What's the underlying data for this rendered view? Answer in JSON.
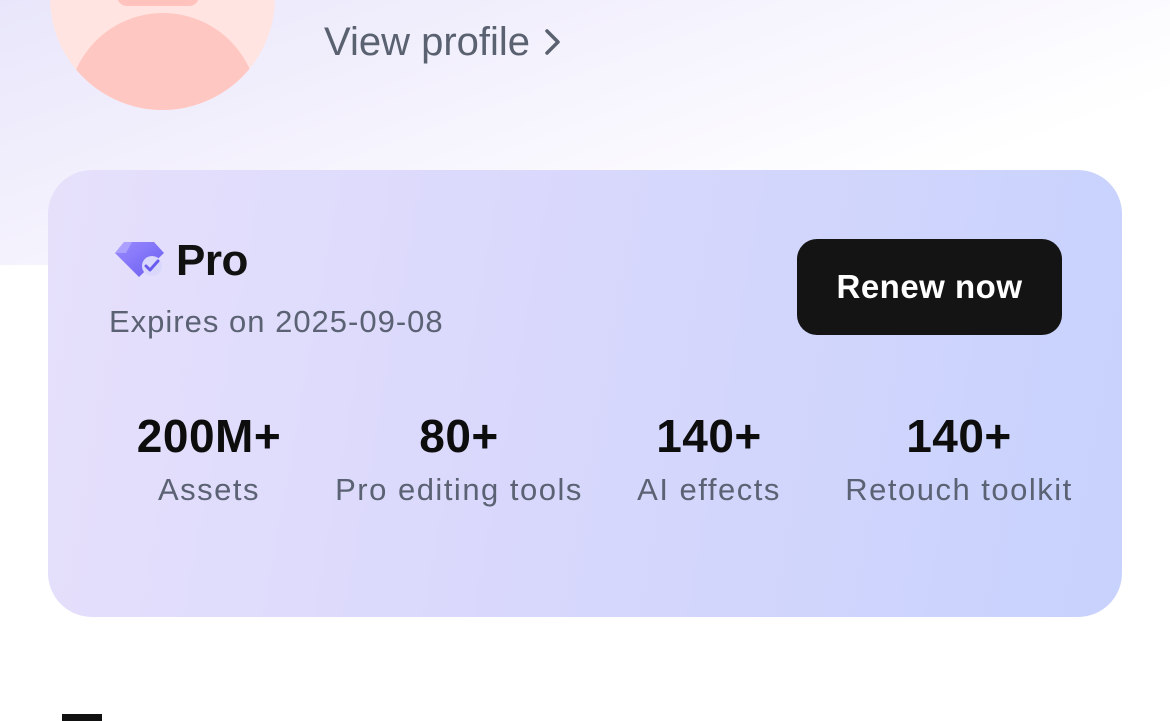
{
  "header": {
    "view_profile_label": "View profile"
  },
  "pro_card": {
    "plan_name": "Pro",
    "expires_text": "Expires on 2025-09-08",
    "renew_label": "Renew now",
    "stats": [
      {
        "value": "200M+",
        "label": "Assets"
      },
      {
        "value": "80+",
        "label": "Pro editing tools"
      },
      {
        "value": "140+",
        "label": "AI effects"
      },
      {
        "value": "140+",
        "label": "Retouch toolkit"
      }
    ]
  },
  "colors": {
    "accent_purple": "#7b6cf6",
    "button_dark": "#141414",
    "avatar_pink": "#ffc7c2"
  },
  "icons": {
    "plan_badge": "diamond-check-icon",
    "view_profile_arrow": "chevron-right-icon"
  }
}
